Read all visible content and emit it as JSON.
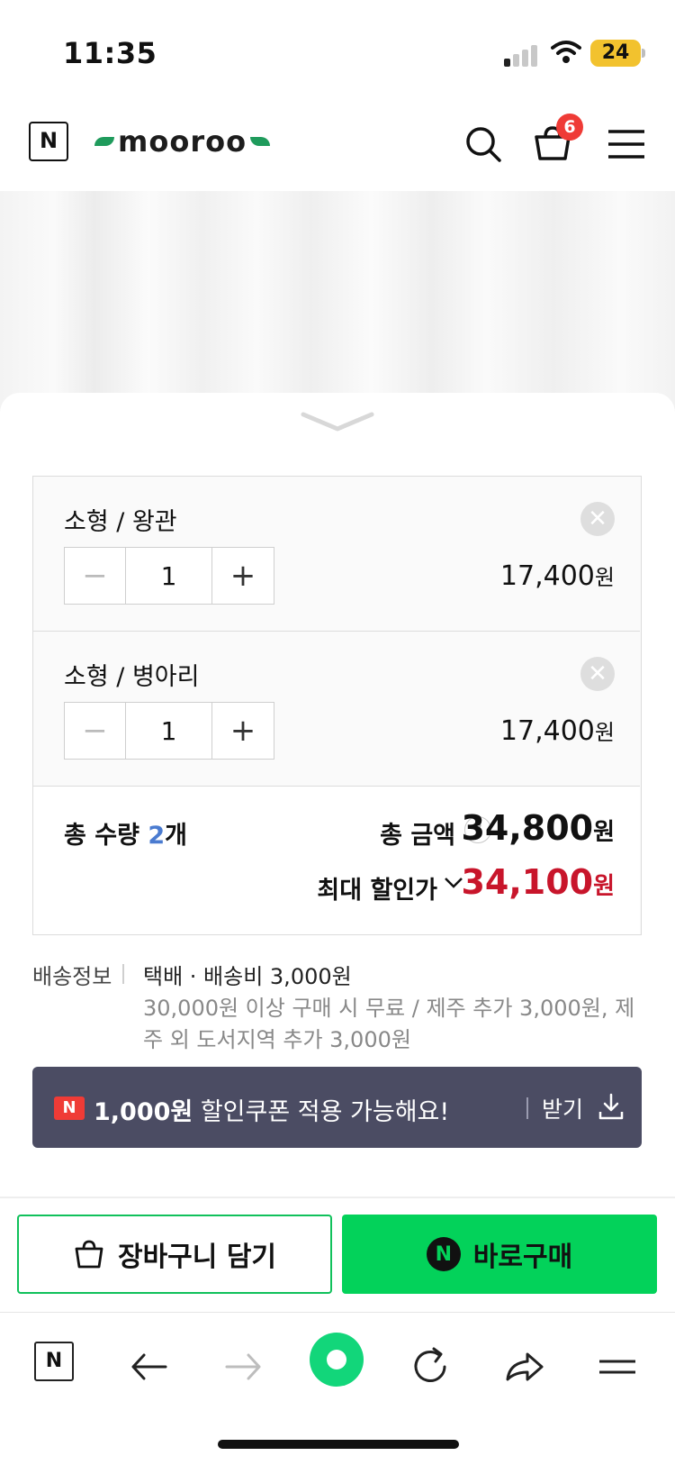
{
  "status_bar": {
    "time": "11:35",
    "battery": "24"
  },
  "header": {
    "brand": "mooroo",
    "n_logo": "N",
    "cart_count": "6"
  },
  "options": [
    {
      "name": "소형 / 왕관",
      "quantity": "1",
      "price": "17,400",
      "currency": "원"
    },
    {
      "name": "소형 / 병아리",
      "quantity": "1",
      "price": "17,400",
      "currency": "원"
    }
  ],
  "totals": {
    "qty_label": "총 수량 ",
    "qty_value": "2",
    "qty_unit": "개",
    "amount_label": "총 금액",
    "amount": "34,800",
    "discount_label": "최대 할인가",
    "discount_amount": "34,100",
    "currency": "원"
  },
  "shipping": {
    "label": "배송정보",
    "method": "택배 · 배송비 3,000원",
    "note": "30,000원 이상 구매 시 무료 / 제주 추가 3,000원, 제주 외 도서지역 추가 3,000원"
  },
  "coupon": {
    "badge": "N",
    "amount": "1,000원",
    "text": " 할인쿠폰 적용 가능해요!",
    "receive": "받기"
  },
  "buttons": {
    "cart": "장바구니 담기",
    "buy": "바로구매",
    "npay": "N"
  },
  "browser_bar": {
    "n_logo": "N"
  },
  "colors": {
    "accent_green": "#03d25a",
    "discount_red": "#c8152b",
    "badge_red": "#ef3b36",
    "coupon_bg": "#4b4c63"
  }
}
